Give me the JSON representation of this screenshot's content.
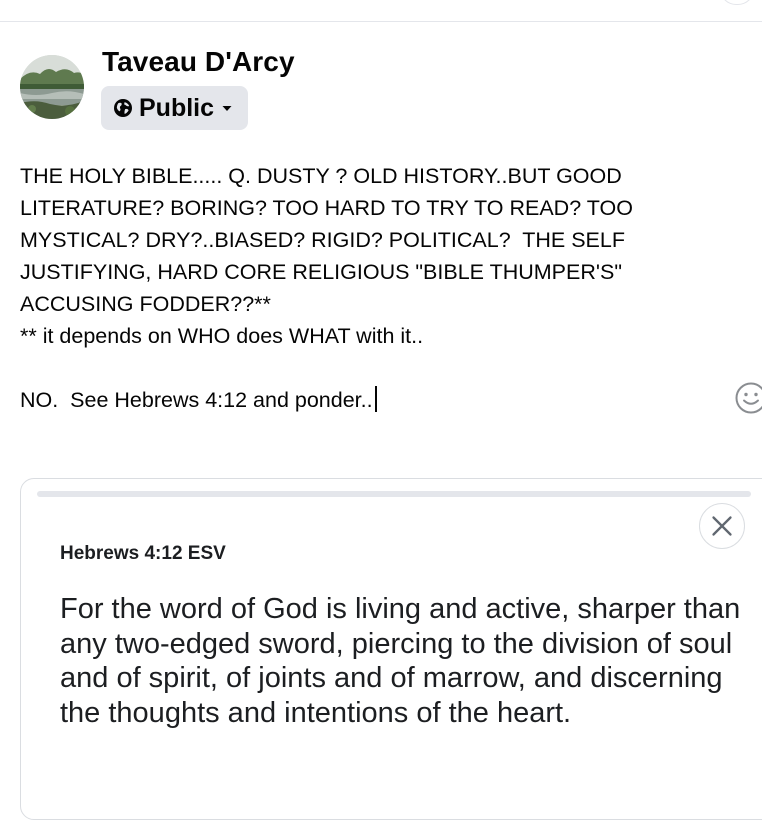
{
  "post": {
    "author_name": "Taveau D'Arcy",
    "audience": {
      "label": "Public",
      "icon": "globe-icon",
      "dropdown_icon": "caret-down-icon"
    },
    "text": "THE HOLY BIBLE..... Q. DUSTY ? OLD HISTORY..BUT GOOD LITERATURE? BORING? TOO HARD TO TRY TO READ? TOO MYSTICAL? DRY?..BIASED? RIGID? POLITICAL?  THE SELF JUSTIFYING, HARD CORE RELIGIOUS \"BIBLE THUMPER'S\" ACCUSING FODDER??**\n** it depends on WHO does WHAT with it..\n\nNO.  See Hebrews 4:12 and ponder..",
    "emoji_icon": "smiley-icon"
  },
  "preview": {
    "reference": "Hebrews 4:12 ESV",
    "verse": "For the word of God is living and active, sharper than any two-edged sword, piercing to the division of soul and of spirit, of joints and of marrow, and discerning the thoughts and intentions of the heart.",
    "close_icon": "close-icon"
  },
  "colors": {
    "audience_bg": "#e4e6eb",
    "text": "#050505",
    "divider": "#e4e6eb",
    "card_border": "#dadde1"
  }
}
